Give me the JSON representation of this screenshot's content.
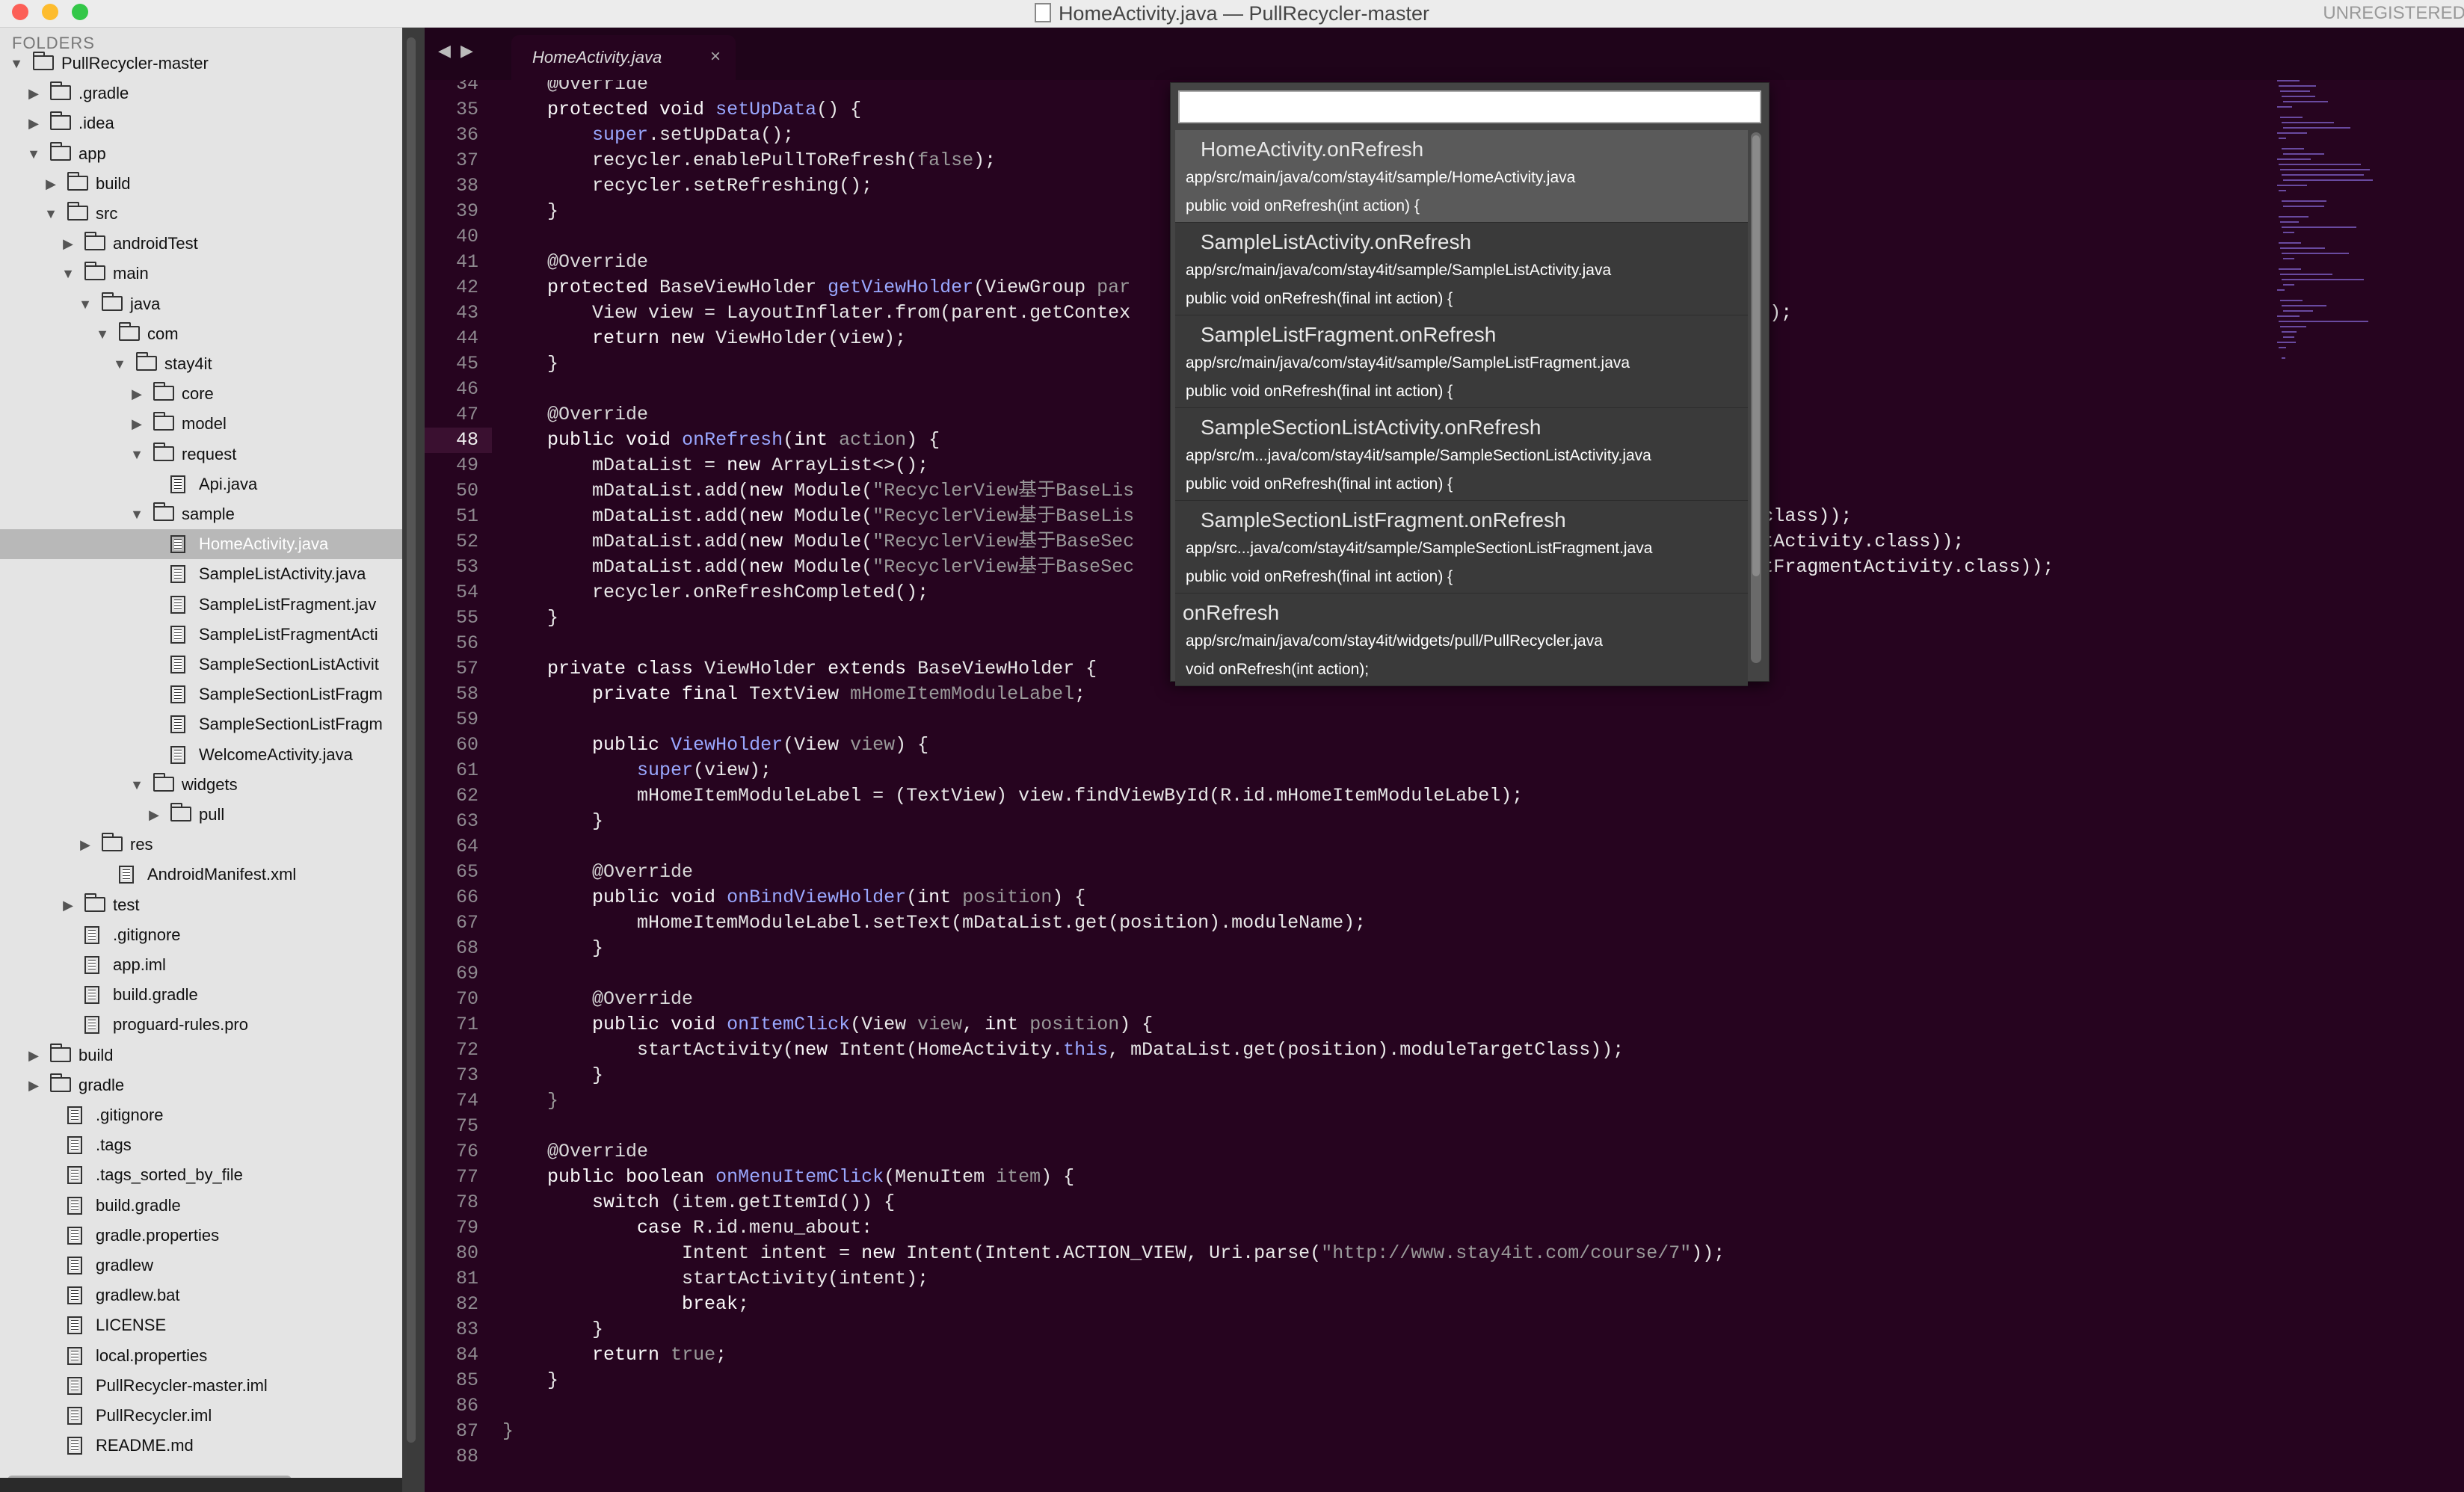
{
  "window": {
    "title": "HomeActivity.java — PullRecycler-master",
    "unregistered": "UNREGISTERED"
  },
  "sidebar": {
    "header": "FOLDERS",
    "items": [
      {
        "label": "PullRecycler-master",
        "indent": 0,
        "type": "folder",
        "open": true
      },
      {
        "label": ".gradle",
        "indent": 1,
        "type": "folder",
        "open": false
      },
      {
        "label": ".idea",
        "indent": 1,
        "type": "folder",
        "open": false
      },
      {
        "label": "app",
        "indent": 1,
        "type": "folder",
        "open": true
      },
      {
        "label": "build",
        "indent": 2,
        "type": "folder",
        "open": false
      },
      {
        "label": "src",
        "indent": 2,
        "type": "folder",
        "open": true
      },
      {
        "label": "androidTest",
        "indent": 3,
        "type": "folder",
        "open": false
      },
      {
        "label": "main",
        "indent": 3,
        "type": "folder",
        "open": true
      },
      {
        "label": "java",
        "indent": 4,
        "type": "folder",
        "open": true
      },
      {
        "label": "com",
        "indent": 5,
        "type": "folder",
        "open": true
      },
      {
        "label": "stay4it",
        "indent": 6,
        "type": "folder",
        "open": true
      },
      {
        "label": "core",
        "indent": 7,
        "type": "folder",
        "open": false
      },
      {
        "label": "model",
        "indent": 7,
        "type": "folder",
        "open": false
      },
      {
        "label": "request",
        "indent": 7,
        "type": "folder",
        "open": true
      },
      {
        "label": "Api.java",
        "indent": 8,
        "type": "file"
      },
      {
        "label": "sample",
        "indent": 7,
        "type": "folder",
        "open": true
      },
      {
        "label": "HomeActivity.java",
        "indent": 8,
        "type": "file",
        "selected": true
      },
      {
        "label": "SampleListActivity.java",
        "indent": 8,
        "type": "file"
      },
      {
        "label": "SampleListFragment.jav",
        "indent": 8,
        "type": "file"
      },
      {
        "label": "SampleListFragmentActi",
        "indent": 8,
        "type": "file"
      },
      {
        "label": "SampleSectionListActivit",
        "indent": 8,
        "type": "file"
      },
      {
        "label": "SampleSectionListFragm",
        "indent": 8,
        "type": "file"
      },
      {
        "label": "SampleSectionListFragm",
        "indent": 8,
        "type": "file"
      },
      {
        "label": "WelcomeActivity.java",
        "indent": 8,
        "type": "file"
      },
      {
        "label": "widgets",
        "indent": 7,
        "type": "folder",
        "open": true
      },
      {
        "label": "pull",
        "indent": 8,
        "type": "folder",
        "open": false
      },
      {
        "label": "res",
        "indent": 4,
        "type": "folder",
        "open": false
      },
      {
        "label": "AndroidManifest.xml",
        "indent": 5,
        "type": "file"
      },
      {
        "label": "test",
        "indent": 3,
        "type": "folder",
        "open": false
      },
      {
        "label": ".gitignore",
        "indent": 3,
        "type": "file"
      },
      {
        "label": "app.iml",
        "indent": 3,
        "type": "file"
      },
      {
        "label": "build.gradle",
        "indent": 3,
        "type": "file"
      },
      {
        "label": "proguard-rules.pro",
        "indent": 3,
        "type": "file"
      },
      {
        "label": "build",
        "indent": 1,
        "type": "folder",
        "open": false
      },
      {
        "label": "gradle",
        "indent": 1,
        "type": "folder",
        "open": false
      },
      {
        "label": ".gitignore",
        "indent": 2,
        "type": "file"
      },
      {
        "label": ".tags",
        "indent": 2,
        "type": "file"
      },
      {
        "label": ".tags_sorted_by_file",
        "indent": 2,
        "type": "file"
      },
      {
        "label": "build.gradle",
        "indent": 2,
        "type": "file"
      },
      {
        "label": "gradle.properties",
        "indent": 2,
        "type": "file"
      },
      {
        "label": "gradlew",
        "indent": 2,
        "type": "file"
      },
      {
        "label": "gradlew.bat",
        "indent": 2,
        "type": "file"
      },
      {
        "label": "LICENSE",
        "indent": 2,
        "type": "file"
      },
      {
        "label": "local.properties",
        "indent": 2,
        "type": "file"
      },
      {
        "label": "PullRecycler-master.iml",
        "indent": 2,
        "type": "file"
      },
      {
        "label": "PullRecycler.iml",
        "indent": 2,
        "type": "file"
      },
      {
        "label": "README.md",
        "indent": 2,
        "type": "file"
      }
    ]
  },
  "tabs": {
    "back": "◀",
    "forward": "▶",
    "active": {
      "label": "HomeActivity.java",
      "close": "×"
    }
  },
  "editor": {
    "current_line": 48,
    "lines": [
      {
        "n": 34,
        "html": "    <span class=\"an\">@Override</span>"
      },
      {
        "n": 35,
        "html": "    <span class=\"kw\">protected void</span> <span class=\"fn\">setUpData</span>() {"
      },
      {
        "n": 36,
        "html": "        <span class=\"sp\">super</span>.setUpData();"
      },
      {
        "n": 37,
        "html": "        recycler.enablePullToRefresh(<span class=\"lit\">false</span>);"
      },
      {
        "n": 38,
        "html": "        recycler.setRefreshing();"
      },
      {
        "n": 39,
        "html": "    }"
      },
      {
        "n": 40,
        "html": ""
      },
      {
        "n": 41,
        "html": "    <span class=\"an\">@Override</span>"
      },
      {
        "n": 42,
        "html": "    <span class=\"kw\">protected</span> BaseViewHolder <span class=\"fn\">getViewHolder</span>(ViewGroup <span class=\"st\">par</span>"
      },
      {
        "n": 43,
        "html": "        View view = LayoutInflater.from(parent.getContex                                                    <span class=\"lit\">false</span>);"
      },
      {
        "n": 44,
        "html": "        <span class=\"kw\">return new</span> ViewHolder(view);"
      },
      {
        "n": 45,
        "html": "    }"
      },
      {
        "n": 46,
        "html": ""
      },
      {
        "n": 47,
        "html": "    <span class=\"an\">@Override</span>"
      },
      {
        "n": 48,
        "html": "    <span class=\"kw\">public void</span> <span class=\"fn\">onRefresh</span>(<span class=\"kw\">int</span> <span class=\"st\">action</span>) {"
      },
      {
        "n": 49,
        "html": "        mDataList = <span class=\"kw\">new</span> ArrayList&lt;&gt;();"
      },
      {
        "n": 50,
        "html": "        mDataList.add(<span class=\"kw\">new</span> Module(<span class=\"st\">\"RecyclerView基于BaseLis</span>                                               .class));"
      },
      {
        "n": 51,
        "html": "        mDataList.add(<span class=\"kw\">new</span> Module(<span class=\"st\">\"RecyclerView基于BaseLis</span>                                               Activity.class));"
      },
      {
        "n": 52,
        "html": "        mDataList.add(<span class=\"kw\">new</span> Module(<span class=\"st\">\"RecyclerView基于BaseSec</span>                                               ectionListActivity.class));"
      },
      {
        "n": 53,
        "html": "        mDataList.add(<span class=\"kw\">new</span> Module(<span class=\"st\">\"RecyclerView基于BaseSec</span>                                               ectionListFragmentActivity.class));"
      },
      {
        "n": 54,
        "html": "        recycler.onRefreshCompleted();"
      },
      {
        "n": 55,
        "html": "    }"
      },
      {
        "n": 56,
        "html": ""
      },
      {
        "n": 57,
        "html": "    <span class=\"kw\">private class</span> ViewHolder <span class=\"kw\">extends</span> BaseViewHolder {"
      },
      {
        "n": 58,
        "html": "        <span class=\"kw\">private final</span> TextView <span class=\"st\">mHomeItemModuleLabel</span>;"
      },
      {
        "n": 59,
        "html": ""
      },
      {
        "n": 60,
        "html": "        <span class=\"kw\">public</span> <span class=\"fn\">ViewHolder</span>(View <span class=\"st\">view</span>) {"
      },
      {
        "n": 61,
        "html": "            <span class=\"sp\">super</span>(view);"
      },
      {
        "n": 62,
        "html": "            mHomeItemModuleLabel = (TextView) view.findViewById(R.id.mHomeItemModuleLabel);"
      },
      {
        "n": 63,
        "html": "        }"
      },
      {
        "n": 64,
        "html": ""
      },
      {
        "n": 65,
        "html": "        <span class=\"an\">@Override</span>"
      },
      {
        "n": 66,
        "html": "        <span class=\"kw\">public void</span> <span class=\"fn\">onBindViewHolder</span>(<span class=\"kw\">int</span> <span class=\"st\">position</span>) {"
      },
      {
        "n": 67,
        "html": "            mHomeItemModuleLabel.setText(mDataList.get(position).moduleName);"
      },
      {
        "n": 68,
        "html": "        }"
      },
      {
        "n": 69,
        "html": ""
      },
      {
        "n": 70,
        "html": "        <span class=\"an\">@Override</span>"
      },
      {
        "n": 71,
        "html": "        <span class=\"kw\">public void</span> <span class=\"fn\">onItemClick</span>(View <span class=\"st\">view</span>, <span class=\"kw\">int</span> <span class=\"st\">position</span>) {"
      },
      {
        "n": 72,
        "html": "            startActivity(<span class=\"kw\">new</span> Intent(HomeActivity.<span class=\"sp\">this</span>, mDataList.get(position).moduleTargetClass));"
      },
      {
        "n": 73,
        "html": "        }"
      },
      {
        "n": 74,
        "html": "    <span class=\"st\">}</span>"
      },
      {
        "n": 75,
        "html": ""
      },
      {
        "n": 76,
        "html": "    <span class=\"an\">@Override</span>"
      },
      {
        "n": 77,
        "html": "    <span class=\"kw\">public boolean</span> <span class=\"fn\">onMenuItemClick</span>(MenuItem <span class=\"st\">item</span>) {"
      },
      {
        "n": 78,
        "html": "        <span class=\"kw\">switch</span> (item.getItemId()) {"
      },
      {
        "n": 79,
        "html": "            <span class=\"kw\">case</span> R.id.menu_about:"
      },
      {
        "n": 80,
        "html": "                Intent intent = <span class=\"kw\">new</span> Intent(Intent.ACTION_VIEW, Uri.parse(<span class=\"st\">\"http://www.stay4it.com/course/7\"</span>));"
      },
      {
        "n": 81,
        "html": "                startActivity(intent);"
      },
      {
        "n": 82,
        "html": "                <span class=\"kw\">break</span>;"
      },
      {
        "n": 83,
        "html": "        }"
      },
      {
        "n": 84,
        "html": "        <span class=\"kw\">return</span> <span class=\"lit\">true</span>;"
      },
      {
        "n": 85,
        "html": "    }"
      },
      {
        "n": 86,
        "html": ""
      },
      {
        "n": 87,
        "html": "<span class=\"st\">}</span>"
      },
      {
        "n": 88,
        "html": ""
      }
    ]
  },
  "goto_symbol": {
    "input_value": "",
    "results": [
      {
        "title": "HomeActivity.onRefresh",
        "path": "app/src/main/java/com/stay4it/sample/HomeActivity.java",
        "signature": "public void onRefresh(int action) {",
        "selected": true
      },
      {
        "title": "SampleListActivity.onRefresh",
        "path": "app/src/main/java/com/stay4it/sample/SampleListActivity.java",
        "signature": "public void onRefresh(final int action) {"
      },
      {
        "title": "SampleListFragment.onRefresh",
        "path": "app/src/main/java/com/stay4it/sample/SampleListFragment.java",
        "signature": "public void onRefresh(final int action) {"
      },
      {
        "title": "SampleSectionListActivity.onRefresh",
        "path": "app/src/m...java/com/stay4it/sample/SampleSectionListActivity.java",
        "signature": "public void onRefresh(final int action) {"
      },
      {
        "title": "SampleSectionListFragment.onRefresh",
        "path": "app/src...java/com/stay4it/sample/SampleSectionListFragment.java",
        "signature": "public void onRefresh(final int action) {"
      },
      {
        "title": "onRefresh",
        "path": "app/src/main/java/com/stay4it/widgets/pull/PullRecycler.java",
        "signature": "void onRefresh(int action);",
        "noindent": true
      }
    ]
  }
}
